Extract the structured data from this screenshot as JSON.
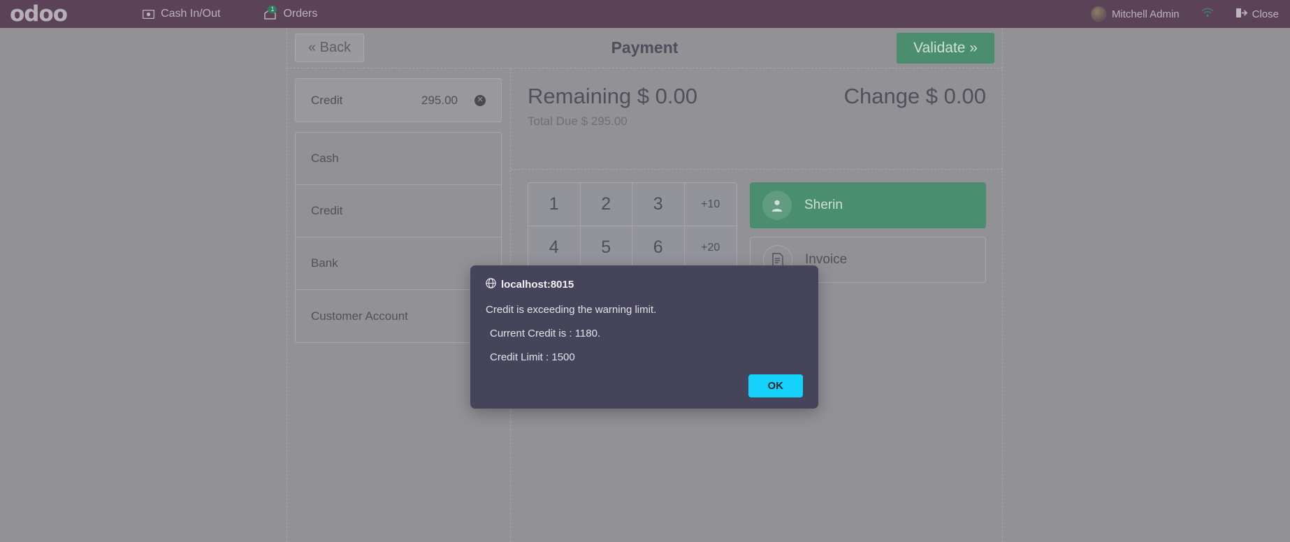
{
  "topbar": {
    "logo": "odoo",
    "nav": [
      {
        "label": "Cash In/Out",
        "icon": "cash-icon"
      },
      {
        "label": "Orders",
        "icon": "orders-icon",
        "badge": "1"
      }
    ],
    "user_name": "Mitchell Admin",
    "wifi_icon": "wifi-icon",
    "close_label": "Close"
  },
  "actions": {
    "back_label": "« Back",
    "title": "Payment",
    "validate_label": "Validate »"
  },
  "payment_lines": [
    {
      "name": "Credit",
      "amount": "295.00",
      "delete_icon": "delete-circle-icon"
    }
  ],
  "payment_methods": [
    {
      "label": "Cash"
    },
    {
      "label": "Credit"
    },
    {
      "label": "Bank"
    },
    {
      "label": "Customer Account"
    }
  ],
  "totals": {
    "remaining_label": "Remaining",
    "remaining_value": "$ 0.00",
    "change_label": "Change",
    "change_value": "$ 0.00",
    "total_due_label": "Total Due",
    "total_due_value": "$ 295.00"
  },
  "numpad": [
    {
      "label": "1"
    },
    {
      "label": "2"
    },
    {
      "label": "3"
    },
    {
      "label": "+10"
    },
    {
      "label": "4"
    },
    {
      "label": "5"
    },
    {
      "label": "6"
    },
    {
      "label": "+20"
    }
  ],
  "side_buttons": {
    "customer_label": "Sherin",
    "customer_icon": "person-icon",
    "invoice_label": "Invoice",
    "invoice_icon": "document-icon"
  },
  "dialog": {
    "origin": "localhost:8015",
    "origin_icon": "globe-icon",
    "line1": "Credit is exceeding the warning limit.",
    "line2": "Current Credit is : 1180.",
    "line3": "Credit Limit : 1500",
    "ok_label": "OK"
  },
  "colors": {
    "topbar": "#5c4257",
    "accent_green": "#4a8d6f",
    "dialog_bg": "#46445a",
    "ok_button": "#14d2fa",
    "page_bg": "#919196"
  }
}
